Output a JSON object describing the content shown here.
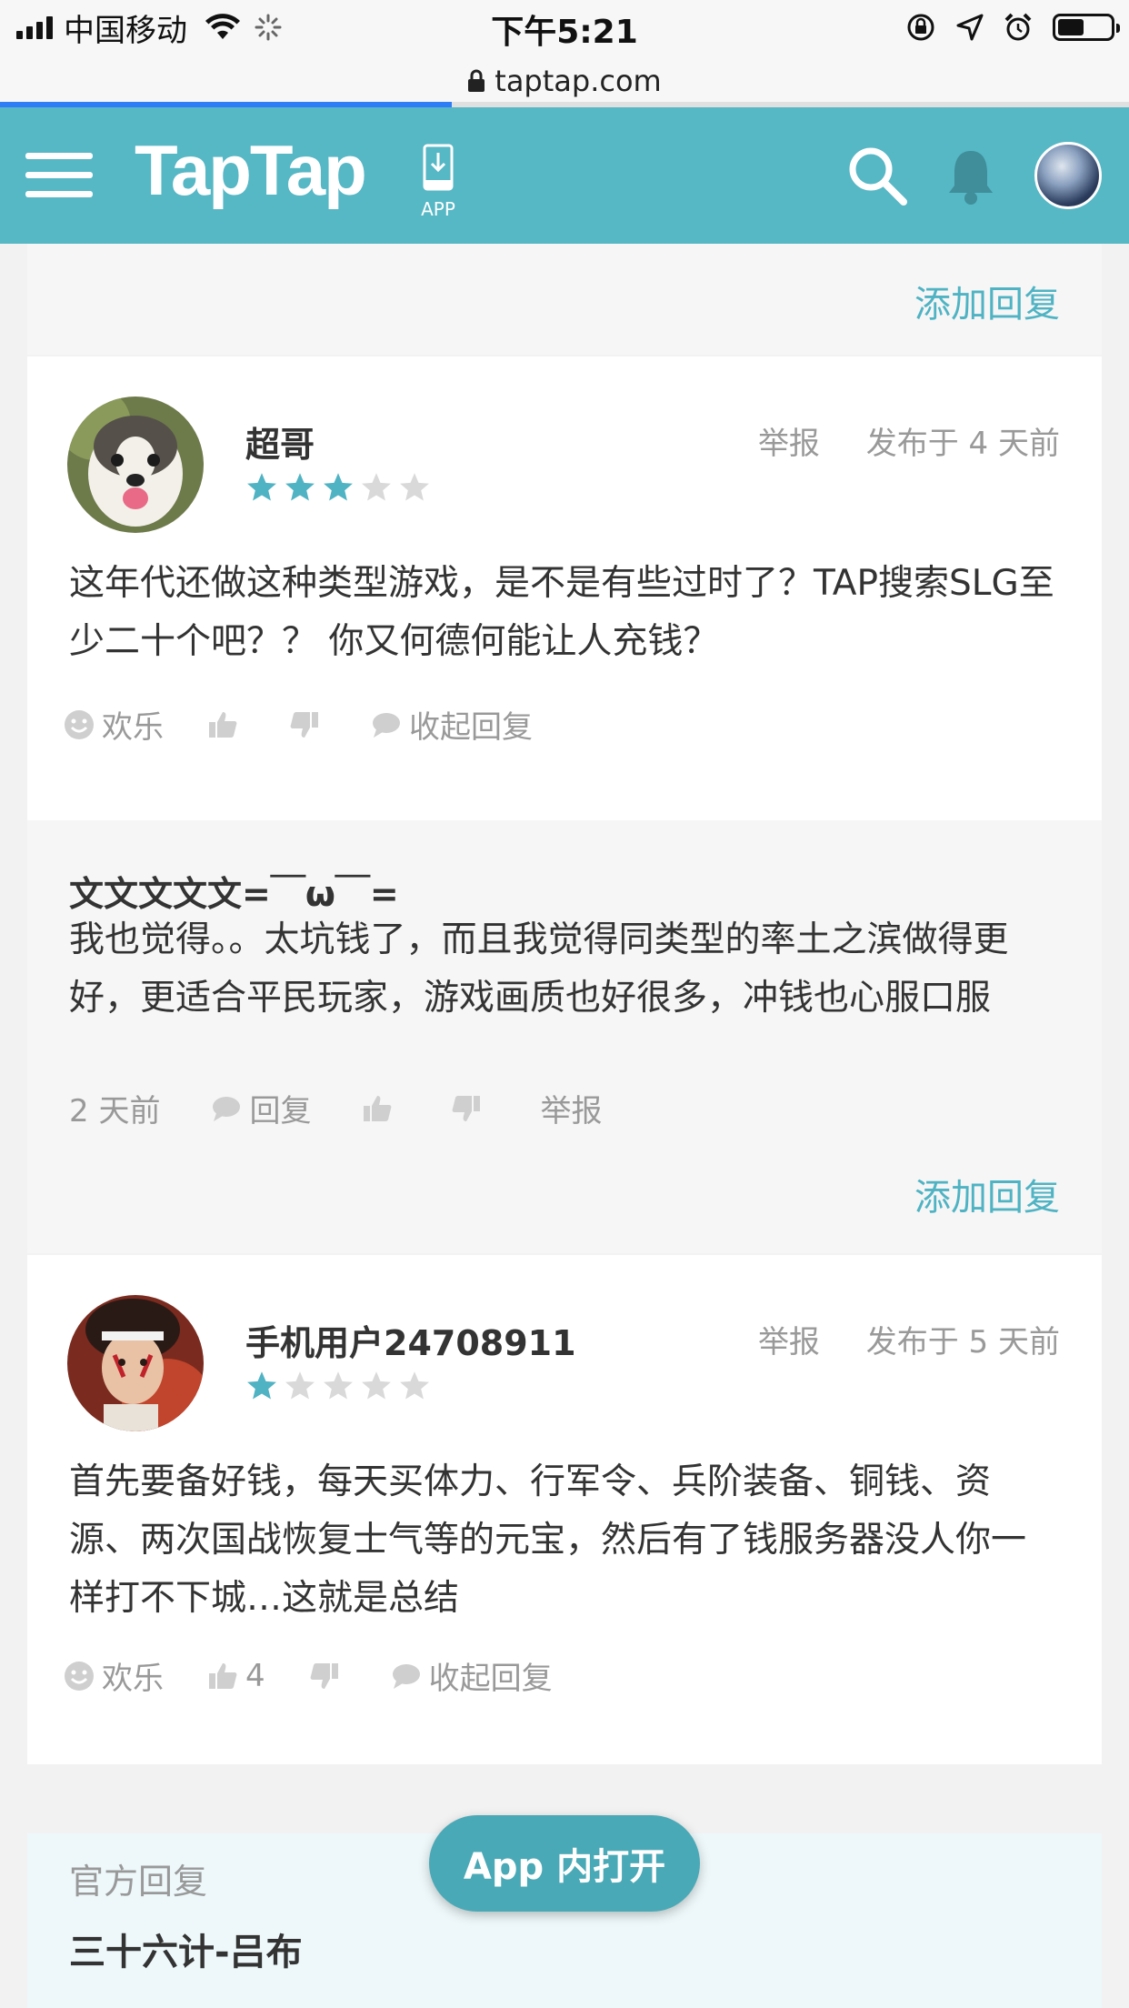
{
  "status_bar": {
    "carrier": "中国移动",
    "time": "下午5:21",
    "battery_level": 0.5
  },
  "browser": {
    "url": "taptap.com",
    "load_progress": 0.4
  },
  "header": {
    "logo": "TapTap",
    "app_label": "APP",
    "icons": [
      "menu-icon",
      "download-app-icon",
      "search-icon",
      "bell-icon",
      "user-avatar"
    ]
  },
  "top_reply_footer": {
    "add_reply": "添加回复"
  },
  "posts": [
    {
      "user": "超哥",
      "report": "举报",
      "posted": "发布于 4 天前",
      "rating": 3,
      "max_rating": 5,
      "body": "这年代还做这种类型游戏，是不是有些过时了？TAP搜索SLG至少二十个吧？？ 你又何德何能让人充钱？",
      "actions": {
        "mood": "欢乐",
        "likes": "",
        "collapse": "收起回复"
      },
      "reply": {
        "user": "文文文文文=￣ω￣=",
        "body": "我也觉得。。太坑钱了，而且我觉得同类型的率土之滨做得更好，更适合平民玩家，游戏画质也好很多，冲钱也心服口服",
        "time": "2 天前",
        "reply_label": "回复",
        "report": "举报"
      },
      "add_reply": "添加回复"
    },
    {
      "user": "手机用户24708911",
      "report": "举报",
      "posted": "发布于 5 天前",
      "rating": 1,
      "max_rating": 5,
      "body": "首先要备好钱，每天买体力、行军令、兵阶装备、铜钱、资源、两次国战恢复士气等的元宝，然后有了钱服务器没人你一样打不下城…这就是总结",
      "actions": {
        "mood": "欢乐",
        "likes": "4",
        "collapse": "收起回复"
      },
      "official": {
        "label": "官方回复",
        "name": "三十六计-吕布"
      }
    }
  ],
  "floating_button": "App 内打开",
  "colors": {
    "brand": "#56b7c5",
    "accent_text": "#4fb3c3",
    "star_on": "#4fb3c3",
    "star_off": "#d9d9d9"
  }
}
